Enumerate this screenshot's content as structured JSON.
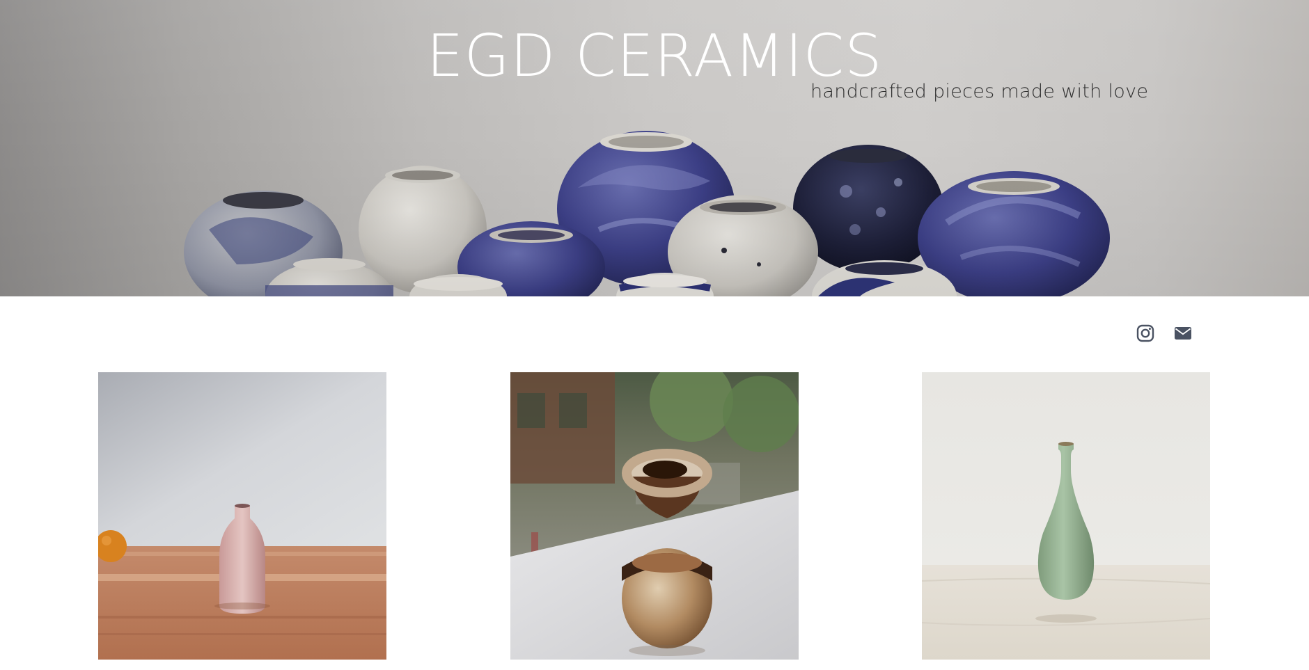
{
  "site": {
    "title": "EGD CERAMICS",
    "tagline": "handcrafted pieces made with love"
  },
  "social": [
    {
      "name": "instagram",
      "icon": "instagram-icon"
    },
    {
      "name": "email",
      "icon": "envelope-icon"
    }
  ],
  "gallery": [
    {
      "subject": "pink bottle vase on wooden table"
    },
    {
      "subject": "brown round vase on window sill"
    },
    {
      "subject": "green narrow-neck bud vase"
    }
  ],
  "colors": {
    "title_text": "#ffffff",
    "tagline_text": "#2e2e2e",
    "icon": "#4a5262",
    "page_background": "#ffffff"
  }
}
